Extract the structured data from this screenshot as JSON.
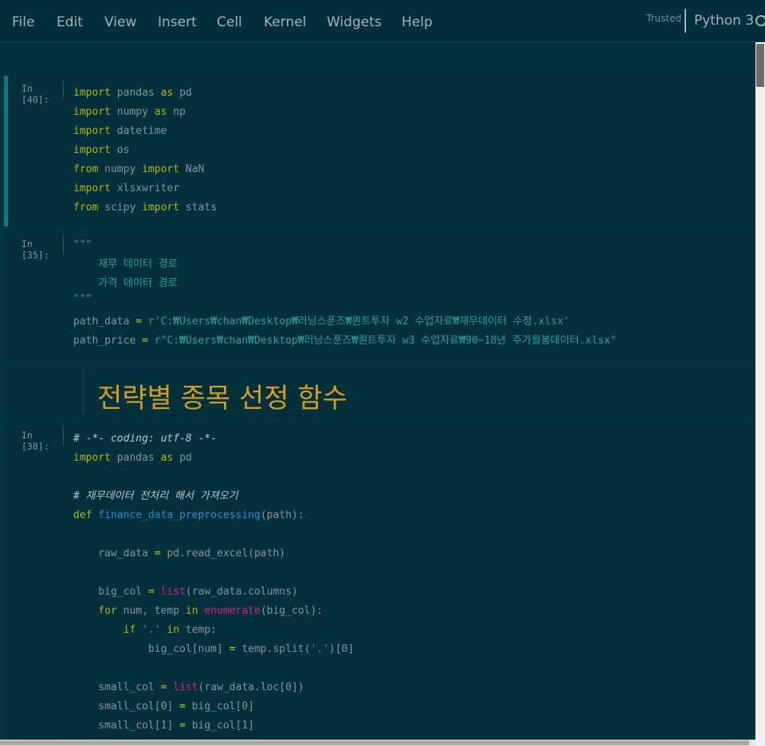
{
  "menubar": {
    "items": [
      "File",
      "Edit",
      "View",
      "Insert",
      "Cell",
      "Kernel",
      "Widgets",
      "Help"
    ],
    "trusted_label": "Trusted",
    "kernel_name": "Python 3"
  },
  "cells": {
    "cell1": {
      "prompt": "In [40]:",
      "lines": [
        [
          "import",
          " pandas ",
          "as",
          " pd"
        ],
        [
          "import",
          " numpy ",
          "as",
          " np"
        ],
        [
          "import",
          " datetime"
        ],
        [
          "import",
          " os"
        ],
        [
          "from",
          " numpy ",
          "import",
          " NaN"
        ],
        [
          "import",
          " xlsxwriter"
        ],
        [
          "from",
          " scipy ",
          "import",
          " stats"
        ]
      ]
    },
    "cell2": {
      "prompt": "In [35]:",
      "doc_open": "\"\"\"",
      "doc_line1": "    재무 데이터 경로",
      "doc_line2": "    가격 데이터 경로",
      "doc_close": "\"\"\"",
      "path_data_var": "path_data ",
      "path_data_eq": "=",
      "path_data_val": " r'C:₩Users₩chan₩Desktop₩러닝스푼즈₩퀀트투자 w2 수업자료₩재무데이터 수정.xlsx'",
      "path_price_var": "path_price ",
      "path_price_eq": "=",
      "path_price_val": " r\"C:₩Users₩chan₩Desktop₩러닝스푼즈₩퀀트투자 w3 수업자료₩90~18년 주가월봉데이터.xlsx\""
    },
    "markdown": {
      "heading": "전략별 종목 선정 함수"
    },
    "cell3": {
      "prompt": "In [38]:",
      "l1": "# -*- coding: utf-8 -*-",
      "l2_kw": "import",
      "l2_a": " pandas ",
      "l2_as": "as",
      "l2_b": " pd",
      "l3": "# 재무데이터 전처리 해서 가져오기",
      "l4_def": "def",
      "l4_fn": " finance_data_preprocessing",
      "l4_rest": "(path):",
      "l5_a": "    raw_data ",
      "l5_eq": "=",
      "l5_b": " pd.read_excel(path)",
      "l6_a": "    big_col ",
      "l6_eq": "=",
      "l6_list": " list",
      "l6_b": "(raw_data.columns)",
      "l7_for": "    for",
      "l7_a": " num, temp ",
      "l7_in": "in",
      "l7_enum": " enumerate",
      "l7_b": "(big_col):",
      "l8_if": "        if",
      "l8_str": " '.'",
      "l8_in": " in",
      "l8_b": " temp:",
      "l9_a": "            big_col[num] ",
      "l9_eq": "=",
      "l9_b": " temp.split(",
      "l9_str": "'.'",
      "l9_c": ")[0]",
      "l10_a": "    small_col ",
      "l10_eq": "=",
      "l10_list": " list",
      "l10_b": "(raw_data.loc[0])",
      "l11_a": "    small_col[0] ",
      "l11_eq": "=",
      "l11_b": " big_col[0]",
      "l12_a": "    small_col[1] ",
      "l12_eq": "=",
      "l12_b": " big_col[1]"
    }
  }
}
